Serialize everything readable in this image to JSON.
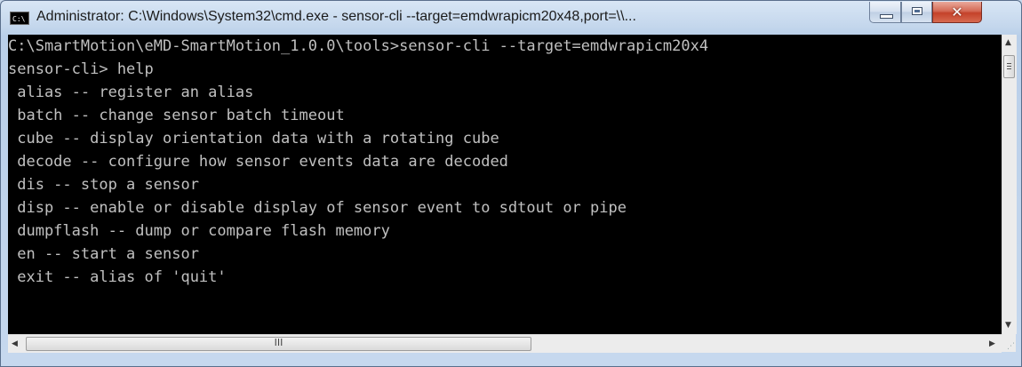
{
  "window": {
    "icon_text": "C:\\",
    "title": "Administrator: C:\\Windows\\System32\\cmd.exe - sensor-cli  --target=emdwrapicm20x48,port=\\\\..."
  },
  "controls": {
    "minimize": "minimize-icon",
    "maximize": "maximize-icon",
    "close": "close-icon",
    "close_glyph": "✕"
  },
  "console": {
    "lines": [
      "C:\\SmartMotion\\eMD-SmartMotion_1.0.0\\tools>sensor-cli --target=emdwrapicm20x4",
      "sensor-cli> help",
      " alias -- register an alias",
      " batch -- change sensor batch timeout",
      " cube -- display orientation data with a rotating cube",
      " decode -- configure how sensor events data are decoded",
      " dis -- stop a sensor",
      " disp -- enable or disable display of sensor event to sdtout or pipe",
      " dumpflash -- dump or compare flash memory",
      " en -- start a sensor",
      " exit -- alias of 'quit'"
    ]
  },
  "scrollbars": {
    "up_arrow": "▲",
    "down_arrow": "▼",
    "left_arrow": "◀",
    "right_arrow": "▶",
    "h_grip": "III"
  }
}
